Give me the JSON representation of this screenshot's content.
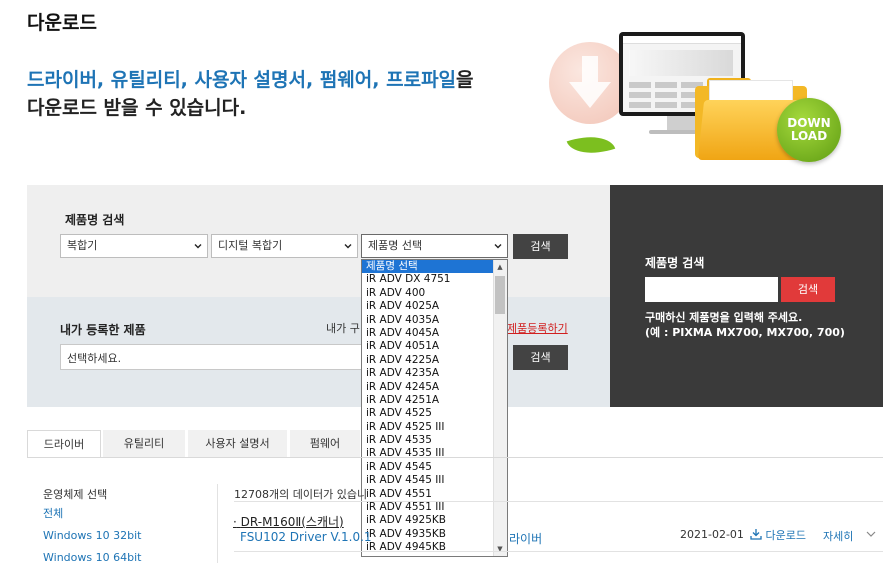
{
  "page_title": "다운로드",
  "hero": {
    "highlight": "드라이버, 유틸리티, 사용자 설명서, 펌웨어, 프로파일",
    "suffix": "을",
    "line2": "다운로드 받을 수 있습니다."
  },
  "illustration": {
    "badge_line1": "DOWN",
    "badge_line2": "LOAD"
  },
  "search": {
    "label": "제품명 검색",
    "category_select": "복합기",
    "subcategory_select": "디지털 복합기",
    "product_select": "제품명 선택",
    "search_button": "검색"
  },
  "registered": {
    "label": "내가 등록한 제품",
    "note_partial": "내가 구",
    "register_link_partial": "제품등록하기",
    "select_value": "선택하세요.",
    "search_button": "검색"
  },
  "name_search": {
    "title": "제품명 검색",
    "search_button": "검색",
    "help_line1": "구매하신 제품명을 입력해 주세요.",
    "help_line2": "(예 : PIXMA MX700, MX700, 700)"
  },
  "product_dropdown": {
    "items": [
      "제품명 선택",
      "iR ADV DX 4751",
      "iR ADV 400",
      "iR ADV 4025A",
      "iR ADV 4035A",
      "iR ADV 4045A",
      "iR ADV 4051A",
      "iR ADV 4225A",
      "iR ADV 4235A",
      "iR ADV 4245A",
      "iR ADV 4251A",
      "iR ADV 4525",
      "iR ADV 4525 III",
      "iR ADV 4535",
      "iR ADV 4535 III",
      "iR ADV 4545",
      "iR ADV 4545 III",
      "iR ADV 4551",
      "iR ADV 4551 III",
      "iR ADV 4925KB",
      "iR ADV 4935KB",
      "iR ADV 4945KB"
    ],
    "selected_index": 0
  },
  "tabs": [
    {
      "label": "드라이버",
      "active": true
    },
    {
      "label": "유틸리티",
      "active": false
    },
    {
      "label": "사용자 설명서",
      "active": false
    },
    {
      "label": "펌웨어",
      "active": false
    }
  ],
  "os_filter": {
    "title": "운영체제 선택",
    "options": [
      "전체",
      "Windows 10 32bit",
      "Windows 10 64bit"
    ]
  },
  "results": {
    "count_text": "12708개의 데이터가 있습니",
    "item": {
      "bullet": "·",
      "product": "DR-M160Ⅱ(스캐너)",
      "desc": "FSU102 Driver V.1.0.1",
      "desc_tail": "라이버",
      "date": "2021-02-01",
      "download": "다운로드",
      "detail": "자세히"
    }
  },
  "colors": {
    "accent_blue": "#1e74b5",
    "red_button": "#e13a3a",
    "dark_panel": "#3a3a3a",
    "selected_option": "#1e74d4"
  }
}
